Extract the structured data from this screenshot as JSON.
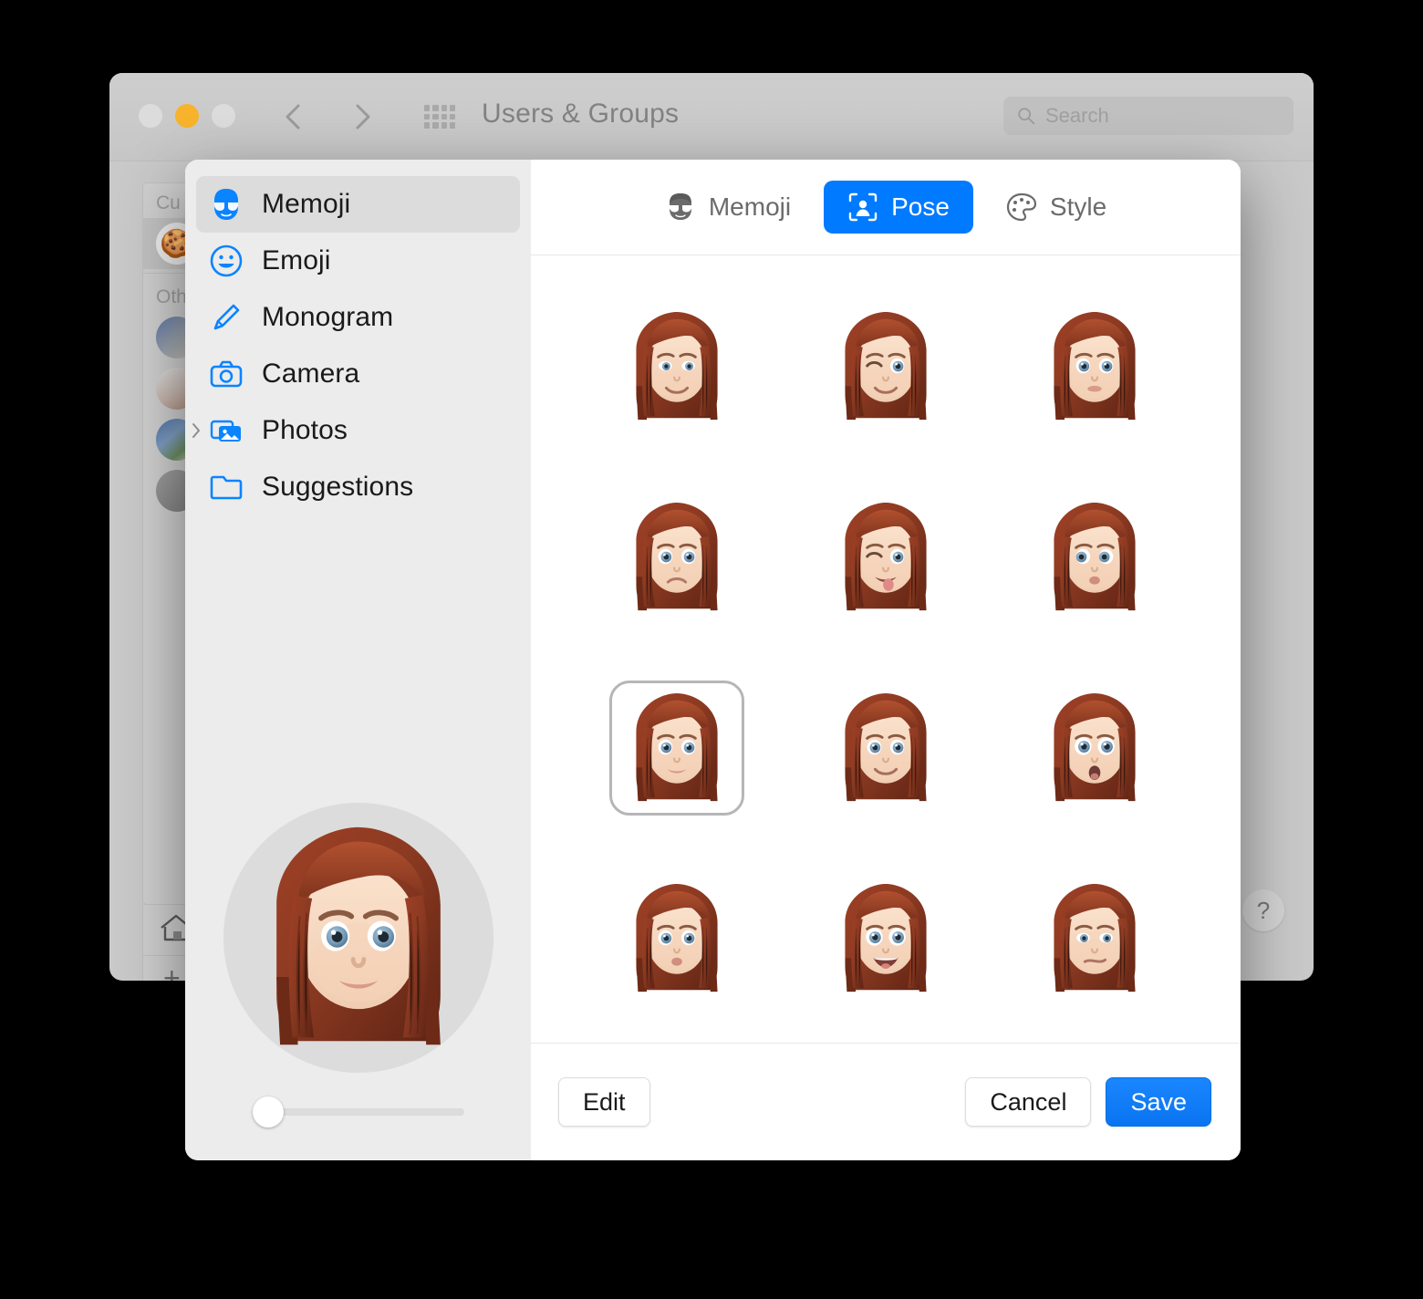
{
  "window": {
    "title": "Users & Groups",
    "traffic_lights": [
      "close-button",
      "minimize-button",
      "zoom-button"
    ],
    "nav_back_icon": "chevron-left-icon",
    "nav_forward_icon": "chevron-right-icon",
    "grid_icon": "show-all-icon",
    "search": {
      "placeholder": "Search",
      "value": "",
      "icon": "search-icon"
    },
    "sidebar": {
      "sections": [
        {
          "label": "Cu",
          "full_label_visible": "Cu",
          "users": [
            {
              "name": "",
              "avatar": "gingerbread-avatar",
              "selected": true
            }
          ]
        },
        {
          "label": "Oth",
          "full_label_visible": "Oth",
          "users": [
            {
              "name": "",
              "avatar": "photo-avatar-1",
              "selected": false
            },
            {
              "name": "",
              "avatar": "photo-avatar-2",
              "selected": false
            },
            {
              "name": "",
              "avatar": "photo-avatar-3",
              "selected": false
            },
            {
              "name": "",
              "avatar": "photo-avatar-4",
              "selected": false
            }
          ]
        }
      ],
      "home_icon": "home-icon",
      "add_button_label": "+"
    },
    "lock_icon": "padlock-locked-icon",
    "help_button_label": "?"
  },
  "dialog": {
    "sidebar": {
      "items": [
        {
          "label": "Memoji",
          "icon": "memoji-sunglasses-icon",
          "selected": true,
          "has_disclosure": false
        },
        {
          "label": "Emoji",
          "icon": "emoji-smiley-icon",
          "selected": false,
          "has_disclosure": false
        },
        {
          "label": "Monogram",
          "icon": "pencil-icon",
          "selected": false,
          "has_disclosure": false
        },
        {
          "label": "Camera",
          "icon": "camera-icon",
          "selected": false,
          "has_disclosure": false
        },
        {
          "label": "Photos",
          "icon": "photos-icon",
          "selected": false,
          "has_disclosure": true
        },
        {
          "label": "Suggestions",
          "icon": "folder-icon",
          "selected": false,
          "has_disclosure": false
        }
      ],
      "preview": {
        "name": "memoji-preview",
        "pose": "neutral-smile"
      },
      "zoom_slider": {
        "name": "zoom-slider",
        "value": 0,
        "min": 0,
        "max": 100
      }
    },
    "tabs": [
      {
        "label": "Memoji",
        "icon": "memoji-face-icon",
        "selected": false
      },
      {
        "label": "Pose",
        "icon": "person-in-frame-icon",
        "selected": true
      },
      {
        "label": "Style",
        "icon": "palette-icon",
        "selected": false
      }
    ],
    "poses": [
      {
        "name": "smiling",
        "selected": false
      },
      {
        "name": "winking-smile",
        "selected": false
      },
      {
        "name": "neutral-glance",
        "selected": false
      },
      {
        "name": "worried",
        "selected": false
      },
      {
        "name": "wink-tongue-out",
        "selected": false
      },
      {
        "name": "side-glance",
        "selected": false
      },
      {
        "name": "calm-smile",
        "selected": true
      },
      {
        "name": "happy-smile",
        "selected": false
      },
      {
        "name": "surprised",
        "selected": false
      },
      {
        "name": "pursed-lips",
        "selected": false
      },
      {
        "name": "big-grin",
        "selected": false
      },
      {
        "name": "skeptical",
        "selected": false
      }
    ],
    "buttons": {
      "edit": "Edit",
      "cancel": "Cancel",
      "save": "Save"
    }
  },
  "colors": {
    "accent_blue": "#007aff",
    "icon_blue": "#0a84ff",
    "sidebar_bg": "#ececec",
    "selected_row": "#dcdcdc",
    "selection_border": "#b6b6b6",
    "minimize_yellow": "#f7b32b"
  }
}
